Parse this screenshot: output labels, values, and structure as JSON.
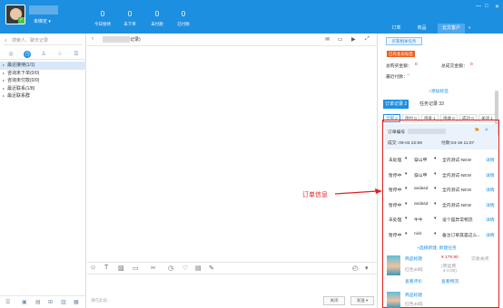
{
  "header": {
    "user_status": "未绑定 ▾",
    "stats": [
      {
        "value": "0",
        "label": "今日接待"
      },
      {
        "value": "0",
        "label": "未下单"
      },
      {
        "value": "0",
        "label": "未付款"
      },
      {
        "value": "0",
        "label": "已付款"
      }
    ],
    "tabs": [
      "订单",
      "商品",
      "云文客户"
    ],
    "window_buttons": [
      "»",
      "—",
      "□",
      "✕"
    ]
  },
  "left": {
    "search_placeholder": "搜索人、聊天记录",
    "list": [
      {
        "label": "最近接待(1/1)",
        "selected": true
      },
      {
        "label": "咨询未下单(0/0)"
      },
      {
        "label": "咨询未付款(0/0)"
      },
      {
        "label": "最近联系(1/8)"
      },
      {
        "label": "最近联系群"
      }
    ]
  },
  "chat": {
    "title_suffix": "记录)",
    "input_placeholder": "请在此处...",
    "close_label": "关闭",
    "send_label": "发送 ▾"
  },
  "right": {
    "tab_label": "买家相关任务",
    "badge": "已有会员标签",
    "stats": {
      "total_label": "总购买金额：",
      "total_value": "0",
      "orders_label": "总成交金额：",
      "orders_value": "0",
      "last_label": "最近付款：",
      "last_value": "--"
    },
    "add_tag": "+添加标签",
    "order_tabs": [
      "订单记录 2",
      "任务记录 33"
    ],
    "filters": [
      "全部 2",
      "待付 0",
      "待发 1",
      "待收 0",
      "成功 0",
      "关闭 1"
    ],
    "order_no_label": "订单编号",
    "order_time": "成交: 09-04 22:59",
    "pay_time": "付款:04-19 11:07",
    "rows": [
      {
        "status": "未处理",
        "person": "穿山甲",
        "desc": "全内测试-NEW",
        "link": "详情"
      },
      {
        "status": "暂停中",
        "person": "穿山甲",
        "desc": "全内测试-NEW",
        "link": "详情"
      },
      {
        "status": "暂停中",
        "person": "asdasd",
        "desc": "全内测试-NEW",
        "link": "详情"
      },
      {
        "status": "暂停中",
        "person": "asdasd",
        "desc": "全内测试-NEW",
        "link": "详情"
      },
      {
        "status": "未处理",
        "person": "牛牛",
        "desc": "设个是异常物流",
        "link": "详情"
      },
      {
        "status": "暂停中",
        "person": "nick",
        "desc": "备注订单其是这么...",
        "link": "详情"
      }
    ],
    "new_order": "+选择新建, 新建任务",
    "products": [
      {
        "title": "商品标题",
        "sub": "红色30码",
        "price": "¥ 179.90",
        "orig": "(原运费",
        "orig2": "¥ 0.00)",
        "status": "交易关闭",
        "link1": "查看评价",
        "link2": "查看物流"
      },
      {
        "title": "商品标题",
        "sub": "红色30码"
      }
    ]
  },
  "annotation": "订单信息"
}
